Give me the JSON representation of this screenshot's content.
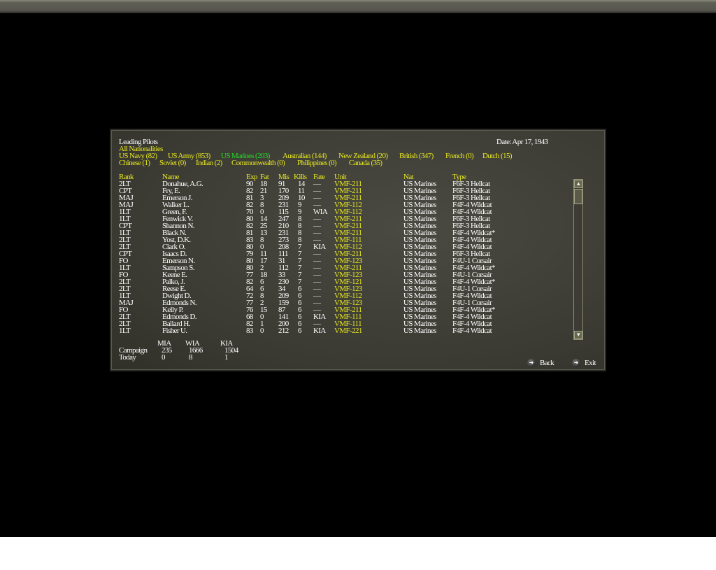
{
  "title": "Leading Pilots",
  "date": "Date: Apr 17, 1943",
  "filters": {
    "all": "All Nationalities",
    "row1": [
      "US Navy (82)",
      "US Army (853)",
      "US Marines (203)",
      "Australian (144)",
      "New Zealand (20)",
      "British (347)",
      "French (0)",
      "Dutch (15)"
    ],
    "row2": [
      "Chinese (1)",
      "Soviet (0)",
      "Indian (2)",
      "Commonwealth (0)",
      "Philippines (0)",
      "Canada (35)"
    ],
    "selected": "US Marines (203)"
  },
  "columns": [
    "Rank",
    "Name",
    "Exp",
    "Fat",
    "Mis",
    "Kills",
    "Fate",
    "Unit",
    "Nat",
    "Type"
  ],
  "rows": [
    [
      "2LT",
      "Donahue, A.G.",
      "90",
      "18",
      "91",
      "14",
      "—",
      "VMF-211",
      "US Marines",
      "F6F-3 Hellcat"
    ],
    [
      "CPT",
      "Fry, E.",
      "82",
      "21",
      "170",
      "11",
      "—",
      "VMF-211",
      "US Marines",
      "F6F-3 Hellcat"
    ],
    [
      "MAJ",
      "Emerson J.",
      "81",
      "3",
      "209",
      "10",
      "—",
      "VMF-211",
      "US Marines",
      "F6F-3 Hellcat"
    ],
    [
      "MAJ",
      "Walker L.",
      "82",
      "8",
      "231",
      "9",
      "—",
      "VMF-112",
      "US Marines",
      "F4F-4 Wildcat"
    ],
    [
      "1LT",
      "Green, F.",
      "70",
      "0",
      "115",
      "9",
      "WIA",
      "VMF-112",
      "US Marines",
      "F4F-4 Wildcat"
    ],
    [
      "1LT",
      "Fenwick V.",
      "80",
      "14",
      "247",
      "8",
      "—",
      "VMF-211",
      "US Marines",
      "F6F-3 Hellcat"
    ],
    [
      "CPT",
      "Shannon N.",
      "82",
      "25",
      "210",
      "8",
      "—",
      "VMF-211",
      "US Marines",
      "F6F-3 Hellcat"
    ],
    [
      "1LT",
      "Black N.",
      "81",
      "13",
      "231",
      "8",
      "—",
      "VMF-211",
      "US Marines",
      "F4F-4 Wildcat*"
    ],
    [
      "2LT",
      "Yost, D.K.",
      "83",
      "8",
      "273",
      "8",
      "—",
      "VMF-111",
      "US Marines",
      "F4F-4 Wildcat"
    ],
    [
      "2LT",
      "Clark O.",
      "80",
      "0",
      "208",
      "7",
      "KIA",
      "VMF-112",
      "US Marines",
      "F4F-4 Wildcat"
    ],
    [
      "CPT",
      "Isaacs D.",
      "79",
      "11",
      "111",
      "7",
      "—",
      "VMF-211",
      "US Marines",
      "F6F-3 Hellcat"
    ],
    [
      "FO",
      "Emerson N.",
      "80",
      "17",
      "31",
      "7",
      "—",
      "VMF-123",
      "US Marines",
      "F4U-1 Corsair"
    ],
    [
      "1LT",
      "Sampson S.",
      "80",
      "2",
      "112",
      "7",
      "—",
      "VMF-211",
      "US Marines",
      "F4F-4 Wildcat*"
    ],
    [
      "FO",
      "Keene E.",
      "77",
      "18",
      "33",
      "7",
      "—",
      "VMF-123",
      "US Marines",
      "F4U-1 Corsair"
    ],
    [
      "2LT",
      "Palko, J.",
      "82",
      "6",
      "230",
      "7",
      "—",
      "VMF-121",
      "US Marines",
      "F4F-4 Wildcat*"
    ],
    [
      "2LT",
      "Reese E.",
      "64",
      "6",
      "34",
      "6",
      "—",
      "VMF-123",
      "US Marines",
      "F4U-1 Corsair"
    ],
    [
      "1LT",
      "Dwight D.",
      "72",
      "8",
      "209",
      "6",
      "—",
      "VMF-112",
      "US Marines",
      "F4F-4 Wildcat"
    ],
    [
      "MAJ",
      "Edmonds N.",
      "77",
      "2",
      "159",
      "6",
      "—",
      "VMF-123",
      "US Marines",
      "F4U-1 Corsair"
    ],
    [
      "FO",
      "Kelly P.",
      "76",
      "15",
      "87",
      "6",
      "—",
      "VMF-211",
      "US Marines",
      "F4F-4 Wildcat*"
    ],
    [
      "2LT",
      "Edmonds D.",
      "68",
      "0",
      "141",
      "6",
      "KIA",
      "VMF-111",
      "US Marines",
      "F4F-4 Wildcat"
    ],
    [
      "2LT",
      "Ballard H.",
      "82",
      "1",
      "200",
      "6",
      "—",
      "VMF-111",
      "US Marines",
      "F4F-4 Wildcat"
    ],
    [
      "1LT",
      "Fisher U.",
      "83",
      "0",
      "212",
      "6",
      "KIA",
      "VMF-221",
      "US Marines",
      "F4F-4 Wildcat"
    ]
  ],
  "summary": {
    "headers": [
      "MIA",
      "WIA",
      "KIA"
    ],
    "campaign_label": "Campaign",
    "campaign": [
      "235",
      "1666",
      "1504"
    ],
    "today_label": "Today",
    "today": [
      "0",
      "8",
      "1"
    ]
  },
  "buttons": {
    "back": "Back",
    "exit": "Exit"
  },
  "colors": {
    "highlight": "#e8e820",
    "selected": "#22dd22"
  }
}
